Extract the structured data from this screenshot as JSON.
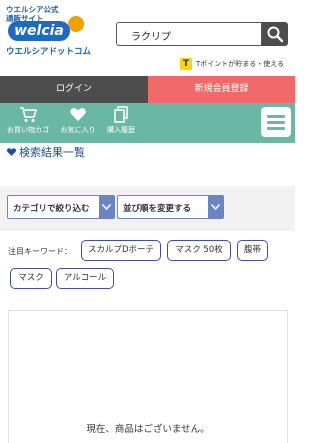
{
  "header": {
    "logo": {
      "top_text": "ウエルシア公式\n通販サイト",
      "brand": "welcia",
      "bottom_text": "ウエルシアドットコム"
    },
    "search": {
      "value": "ラクリプ",
      "icon": "search-icon"
    },
    "tpoint": {
      "icon_letter": "T",
      "text": "Tポイントが貯まる・使える"
    }
  },
  "auth": {
    "login_label": "ログイン",
    "register_label": "新規会員登録"
  },
  "nav": {
    "items": [
      {
        "label": "お買い物カゴ",
        "icon": "cart-icon"
      },
      {
        "label": "お気に入り",
        "icon": "heart-icon"
      },
      {
        "label": "購入履歴",
        "icon": "document-icon"
      }
    ],
    "menu_icon": "hamburger-menu-icon"
  },
  "results": {
    "title": "検索結果一覧"
  },
  "filters": {
    "category_label": "カテゴリで絞り込む",
    "sort_label": "並び順を変更する"
  },
  "keywords": {
    "label": "注目キーワード：",
    "chips": [
      "スカルプDボーテ",
      "マスク 50枚",
      "腹帯",
      "マスク",
      "アルコール"
    ]
  },
  "empty_message": "現在、商品はございません。",
  "colors": {
    "brand_blue": "#1f69c4",
    "login_bg": "#4d4d4d",
    "register_bg": "#f06a6a",
    "nav_bg": "#6ab8a4",
    "link_blue": "#1b4ea0",
    "chip_border": "#3f4ea8"
  }
}
